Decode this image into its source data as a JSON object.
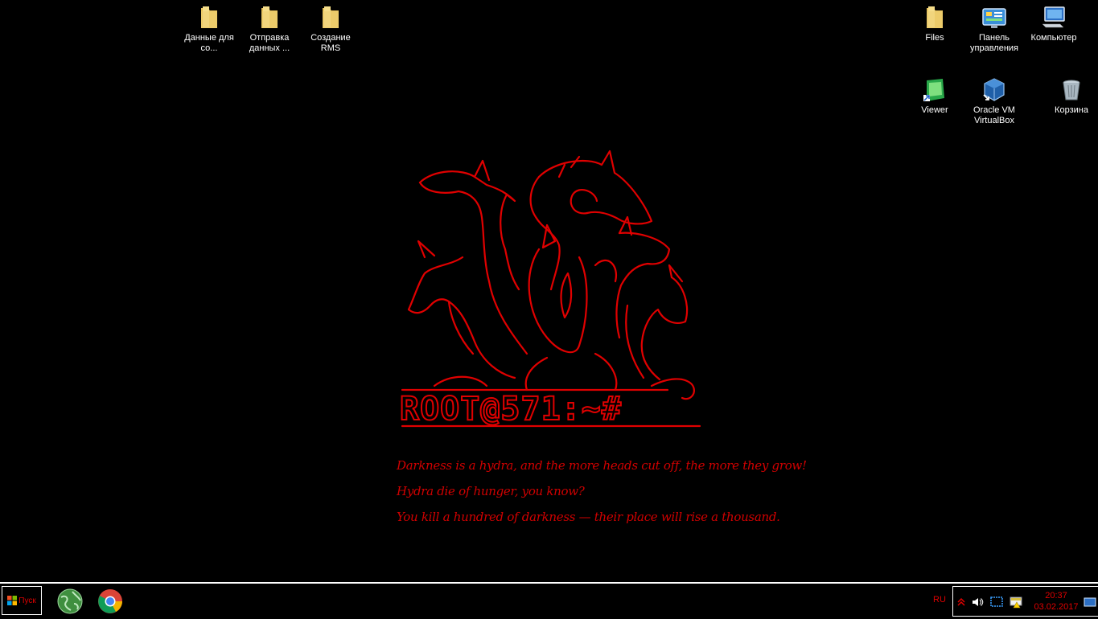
{
  "desktop_icons_left": [
    {
      "label": "Данные для со...",
      "icon": "folder-icon"
    },
    {
      "label": "Отправка данных ...",
      "icon": "folder-icon"
    },
    {
      "label": "Создание RMS",
      "icon": "folder-icon"
    }
  ],
  "desktop_icons_right": [
    {
      "label": "Files",
      "icon": "folder-icon"
    },
    {
      "label": "Панель управления",
      "icon": "control-panel-icon"
    },
    {
      "label": "Компьютер",
      "icon": "computer-icon"
    },
    {
      "label": "Viewer",
      "icon": "viewer-icon"
    },
    {
      "label": "Oracle VM VirtualBox",
      "icon": "virtualbox-icon"
    },
    {
      "label": "Корзина",
      "icon": "recycle-bin-icon"
    }
  ],
  "wallpaper": {
    "brand": "ROOT@571:~#",
    "quote_lines": [
      "Darkness is a hydra, and the more heads cut off, the more they grow!",
      "Hydra die of hunger, you know?",
      "You kill a hundred of darkness — their place will rise a thousand."
    ],
    "accent_color": "#e00000"
  },
  "taskbar": {
    "start_label": "Пуск",
    "pinned_apps": [
      "network-globe-icon",
      "chrome-icon"
    ],
    "language": "RU",
    "tray_icons": [
      "show-hidden-icons-icon",
      "volume-icon",
      "network-icon",
      "action-center-icon"
    ],
    "time": "20:37",
    "date": "03.02.2017"
  }
}
